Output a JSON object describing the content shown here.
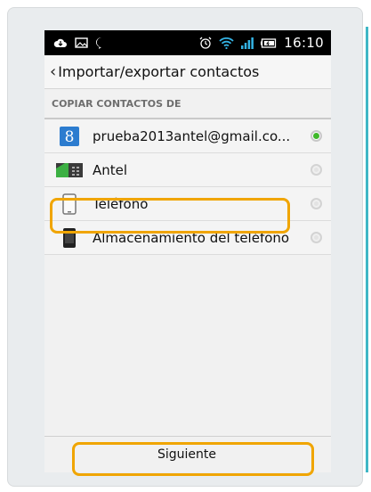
{
  "statusbar": {
    "time": "16:10",
    "left_icons": [
      "cloud-icon",
      "image-icon",
      "messenger-icon"
    ],
    "right_icons": [
      "alarm-icon",
      "wifi-icon",
      "signal-icon",
      "battery-icon"
    ]
  },
  "appbar": {
    "title": "Importar/exportar contactos"
  },
  "section": {
    "header": "COPIAR CONTACTOS DE"
  },
  "items": [
    {
      "label": "prueba2013antel@gmail.co...",
      "icon": "google-icon",
      "selected": true
    },
    {
      "label": "Antel",
      "icon": "sim-card-icon",
      "selected": false
    },
    {
      "label": "Teléfono",
      "icon": "phone-device-icon",
      "selected": false
    },
    {
      "label": "Almacenamiento del teléfono",
      "icon": "phone-storage-icon",
      "selected": false
    }
  ],
  "footer": {
    "next_label": "Siguiente"
  },
  "colors": {
    "highlight": "#f0a500",
    "radio_on": "#3fb82a",
    "google_blue": "#2c7ccf",
    "accent": "#3fb7c6"
  }
}
